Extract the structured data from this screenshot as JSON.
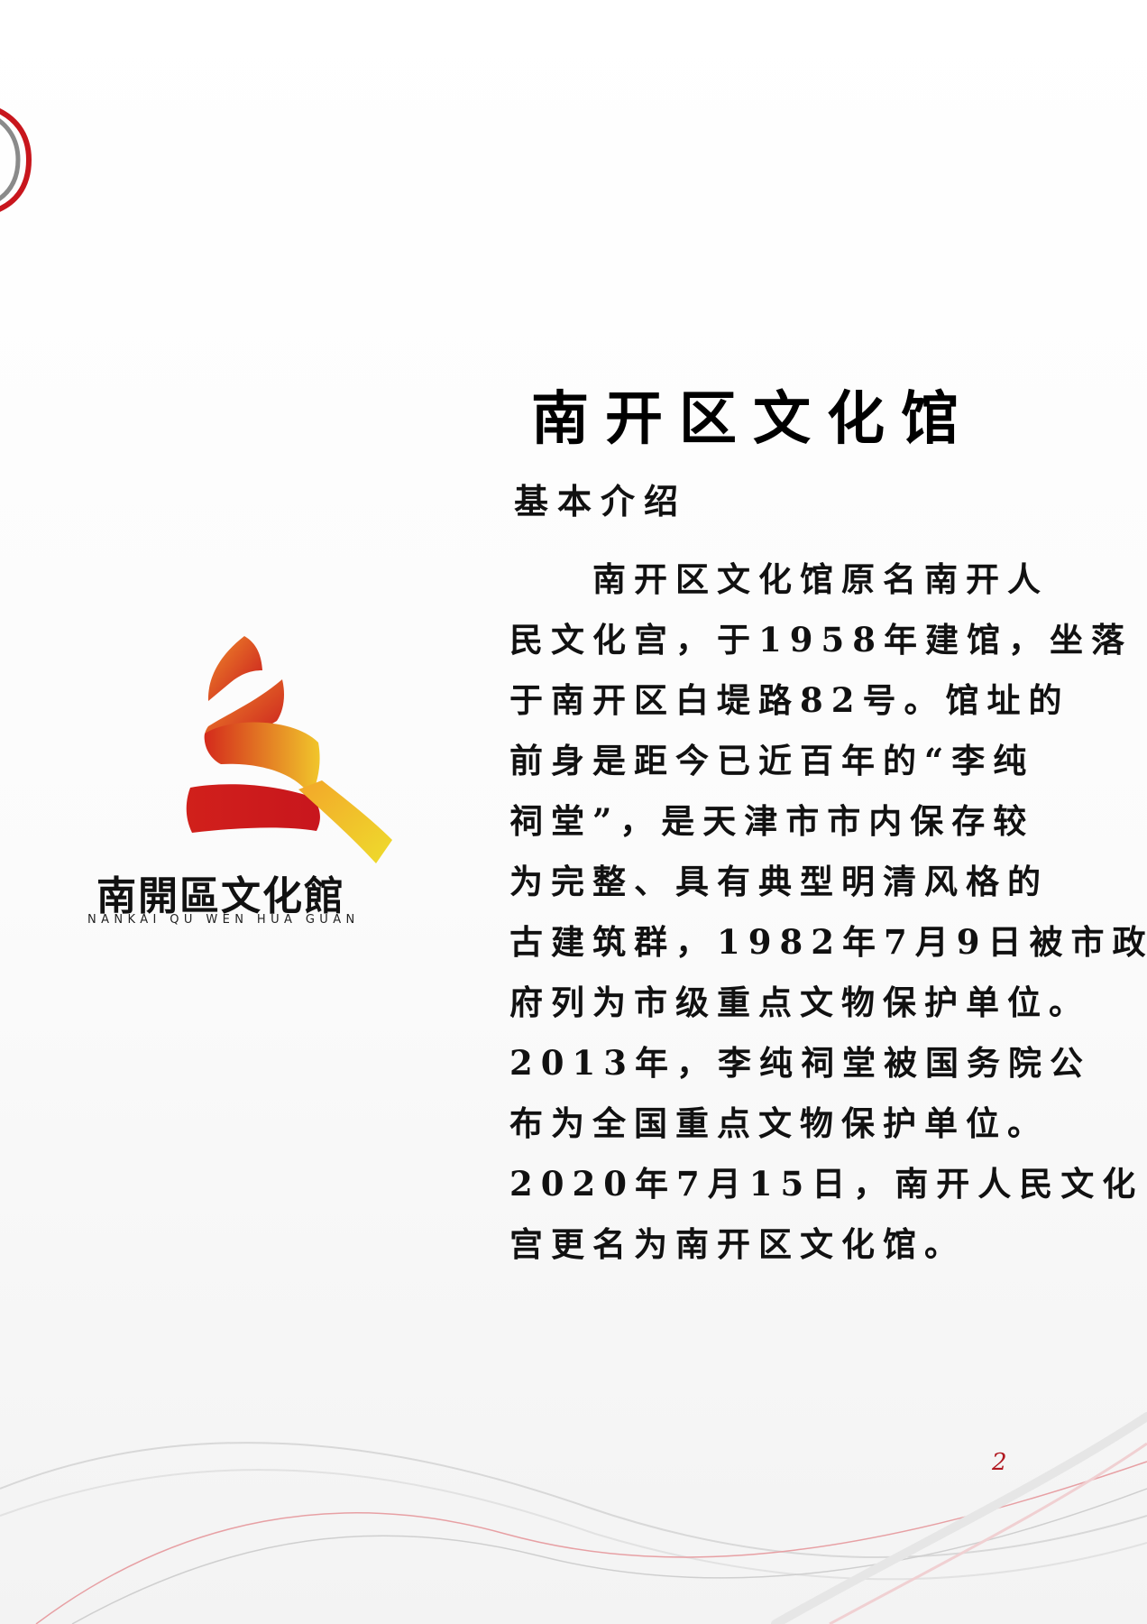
{
  "logo": {
    "name_cn": "南開區文化館",
    "name_pinyin": "NANKAI QU WEN HUA GUAN",
    "colors": {
      "red": "#d42a1c",
      "orange": "#ee7a1e",
      "yellow": "#f1c62b"
    }
  },
  "title": "南开区文化馆",
  "subtitle": "基本介绍",
  "body_lines": [
    "南开区文化馆原名南开人",
    "民文化宫，于1958年建馆，坐落",
    "于南开区白堤路82号。馆址的",
    "前身是距今已近百年的“李纯",
    "祠堂”，是天津市市内保存较",
    "为完整、具有典型明清风格的",
    "古建筑群，1982年7月9日被市政",
    "府列为市级重点文物保护单位。",
    "2013年，李纯祠堂被国务院公",
    "布为全国重点文物保护单位。",
    "2020年7月15日，南开人民文化",
    "宫更名为南开区文化馆。"
  ],
  "page_number": "2",
  "colors": {
    "accent_red": "#b0171f",
    "swoosh_gray": "#d8d8d8",
    "swoosh_red": "#e7a0a4"
  }
}
